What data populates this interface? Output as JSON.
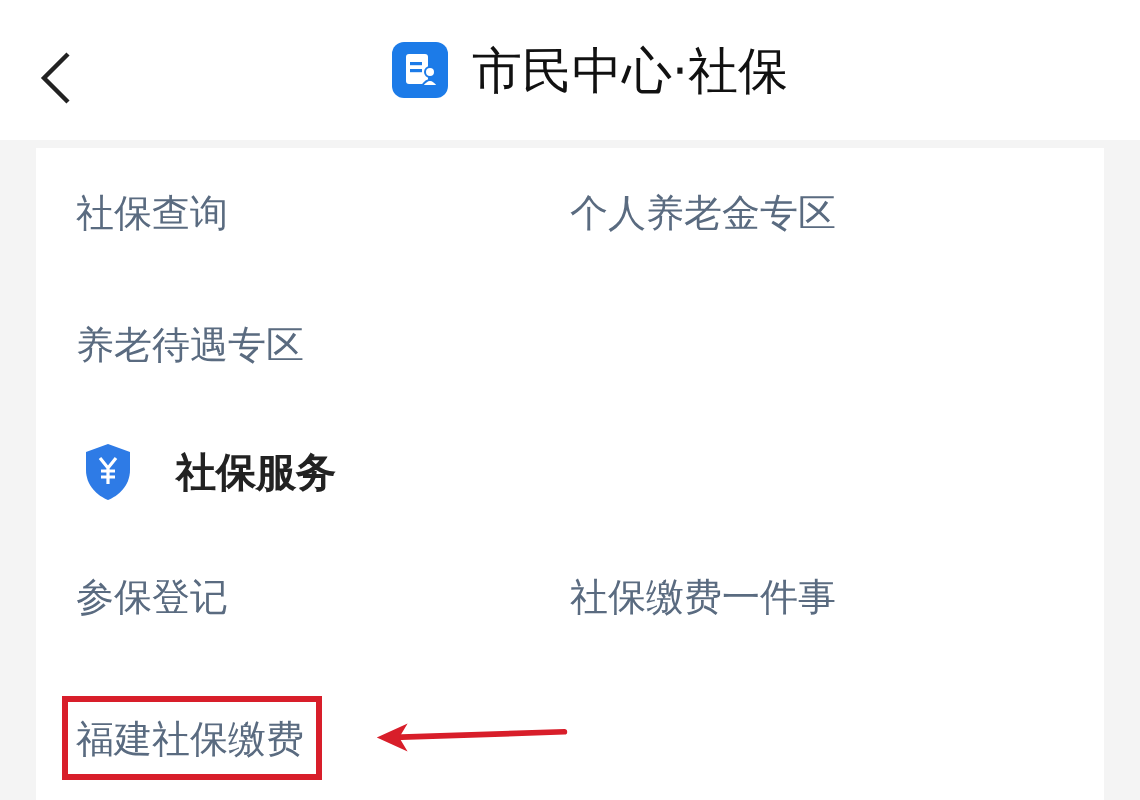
{
  "header": {
    "title": "市民中心·社保"
  },
  "groups": [
    {
      "kind": "links",
      "items": [
        {
          "label": "社保查询",
          "highlighted": false
        },
        {
          "label": "个人养老金专区",
          "highlighted": false
        },
        {
          "label": "养老待遇专区",
          "highlighted": false
        }
      ]
    },
    {
      "kind": "section",
      "title": "社保服务",
      "items": [
        {
          "label": "参保登记",
          "highlighted": false
        },
        {
          "label": "社保缴费一件事",
          "highlighted": false
        },
        {
          "label": "福建社保缴费",
          "highlighted": true
        }
      ]
    }
  ]
}
